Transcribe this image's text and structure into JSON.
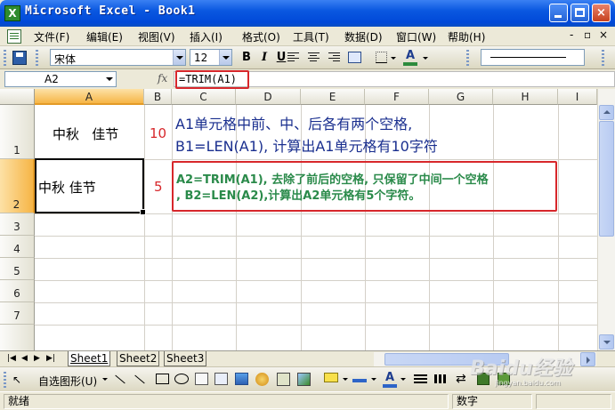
{
  "window": {
    "title": "Microsoft Excel - Book1",
    "app_icon": "excel-icon",
    "min_label": "_",
    "close_label": "×"
  },
  "menu": {
    "items": [
      "文件(F)",
      "编辑(E)",
      "视图(V)",
      "插入(I)",
      "格式(O)",
      "工具(T)",
      "数据(D)",
      "窗口(W)",
      "帮助(H)"
    ],
    "doc_min": "-",
    "doc_restore": "▫",
    "doc_close": "×"
  },
  "toolbar": {
    "font_name": "宋体",
    "font_size": "12",
    "bold": "B",
    "italic": "I",
    "underline": "U",
    "font_color_label": "A"
  },
  "formula_bar": {
    "name_box": "A2",
    "fx": "fx",
    "formula": "=TRIM(A1)"
  },
  "grid": {
    "columns": [
      "A",
      "B",
      "C",
      "D",
      "E",
      "F",
      "G",
      "H",
      "I"
    ],
    "rows": [
      "1",
      "2",
      "3",
      "4",
      "5",
      "6",
      "7"
    ],
    "a1": "中秋   佳节",
    "b1": "10",
    "a2": "中秋 佳节",
    "b2": "5",
    "note1_line1": "A1单元格中前、中、后各有两个空格,",
    "note1_line2": "B1=LEN(A1), 计算出A1单元格有10字符",
    "note2_line1": "A2=TRIM(A1), 去除了前后的空格, 只保留了中间一个空格",
    "note2_line2": ", B2=LEN(A2),计算出A2单元格有5个字符。"
  },
  "sheets": {
    "tabs": [
      "Sheet1",
      "Sheet2",
      "Sheet3"
    ],
    "active": "Sheet1"
  },
  "draw_toolbar": {
    "autoshapes": "自选图形(U)",
    "font_color_label": "A"
  },
  "status": {
    "left": "就绪",
    "right": "数字"
  },
  "watermark": {
    "text": "Baidu经验",
    "sub": "jingyan.baidu.com"
  },
  "colors": {
    "red_text": "#d7272b",
    "note1_text": "#1a2f8f",
    "note2_text": "#2a8a4a",
    "selection": "#f6b546"
  }
}
